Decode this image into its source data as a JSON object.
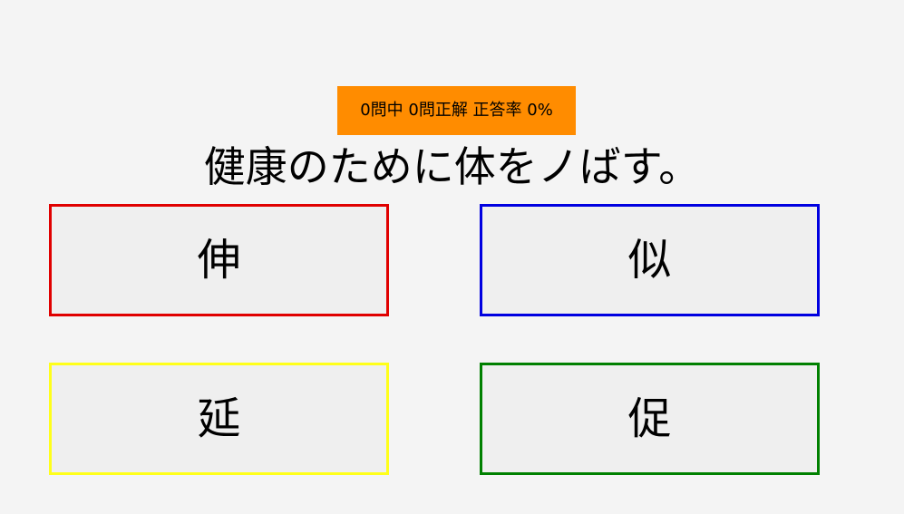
{
  "score": {
    "text": "0問中 0問正解 正答率 0%",
    "color": "#ff8c00"
  },
  "question": {
    "text": "健康のために体をノばす。"
  },
  "choices": [
    {
      "label": "伸",
      "border_color": "#e00000"
    },
    {
      "label": "似",
      "border_color": "#0000e0"
    },
    {
      "label": "延",
      "border_color": "#ffff1a"
    },
    {
      "label": "促",
      "border_color": "#008000"
    }
  ]
}
